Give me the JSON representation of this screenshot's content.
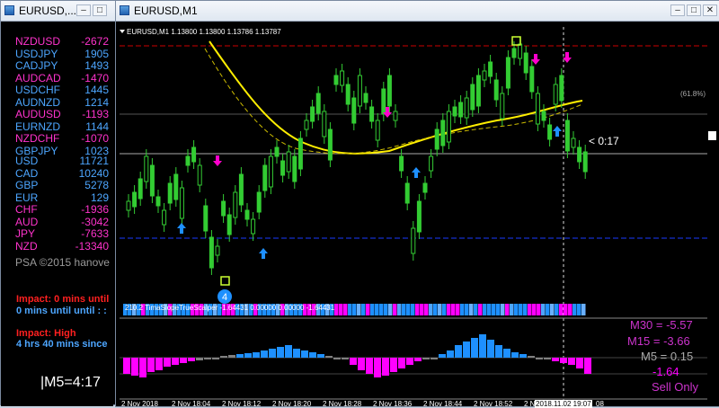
{
  "left_window": {
    "title": "EURUSD,..."
  },
  "pairs": [
    {
      "name": "NZDUSD",
      "value": "-2672",
      "color": "mag"
    },
    {
      "name": "USDJPY",
      "value": "1905",
      "color": "blu"
    },
    {
      "name": "CADJPY",
      "value": "1493",
      "color": "blu"
    },
    {
      "name": "AUDCAD",
      "value": "-1470",
      "color": "mag"
    },
    {
      "name": "USDCHF",
      "value": "1445",
      "color": "blu"
    },
    {
      "name": "AUDNZD",
      "value": "1214",
      "color": "blu"
    },
    {
      "name": "AUDUSD",
      "value": "-1193",
      "color": "mag"
    },
    {
      "name": "EURNZD",
      "value": "1144",
      "color": "blu"
    },
    {
      "name": "NZDCHF",
      "value": "-1070",
      "color": "mag"
    },
    {
      "name": "GBPJPY",
      "value": "1023",
      "color": "blu"
    }
  ],
  "currencies": [
    {
      "name": "USD",
      "value": "11721",
      "color": "blu"
    },
    {
      "name": "CAD",
      "value": "10240",
      "color": "blu"
    },
    {
      "name": "GBP",
      "value": "5278",
      "color": "blu"
    },
    {
      "name": "EUR",
      "value": "129",
      "color": "blu"
    },
    {
      "name": "CHF",
      "value": "-1936",
      "color": "mag"
    },
    {
      "name": "AUD",
      "value": "-3042",
      "color": "mag"
    },
    {
      "name": "JPY",
      "value": "-7633",
      "color": "mag"
    },
    {
      "name": "NZD",
      "value": "-13340",
      "color": "mag"
    }
  ],
  "psa": "PSA ©2015 hanove",
  "impact": {
    "line1": "Impact: 0 mins until",
    "line2": "0 mins until until : :",
    "line3": "Impact: High",
    "line4": "4 hrs 40 mins since"
  },
  "m5_timer": "|M5=4:17",
  "chart_window": {
    "title": "EURUSD,M1",
    "symbol_line": "EURUSD,M1  1.13800  1.13800  1.13786  1.13787",
    "fib_label": "(61.8%)",
    "countdown": "< 0:17",
    "marker_label": "4"
  },
  "indicator": {
    "header": "210.2 TimaSlopeTrueScalper -1.64431 0.00000 0.00000 -1.64431",
    "m30": "M30 = -5.57",
    "m15": "M15 = -3.66",
    "m5": "M5 = 0.15",
    "value": "-1.64",
    "signal": "Sell Only"
  },
  "time_axis": [
    "2 Nov 2018",
    "2 Nov 18:04",
    "2 Nov 18:12",
    "2 Nov 18:20",
    "2 Nov 18:28",
    "2 Nov 18:36",
    "2 Nov 18:44",
    "2 Nov 18:52",
    "2 N"
  ],
  "time_highlight": "2018.11.02 19:07",
  "time_tail": "08",
  "colors": {
    "bull": "#33cc33",
    "up_arrow": "#1e90ff",
    "down_arrow": "#ff00cc",
    "ma_fast": "#ffee00",
    "ma_slow": "#ccbb00",
    "hist_pos": "#1e90ff",
    "hist_neg": "#ff00ff",
    "hist_flat": "#808080"
  }
}
